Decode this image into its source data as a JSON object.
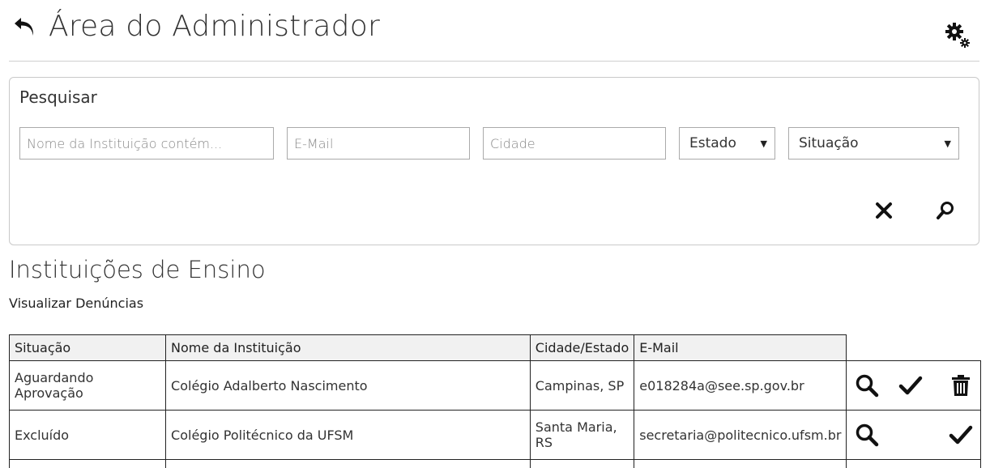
{
  "header": {
    "title": "Área do Administrador"
  },
  "search": {
    "title": "Pesquisar",
    "name_placeholder": "Nome da Instituição contém...",
    "email_placeholder": "E-Mail",
    "city_placeholder": "Cidade",
    "state_selected": "Estado",
    "status_selected": "Situação"
  },
  "section": {
    "title": "Instituições de Ensino",
    "denuncias_link": "Visualizar Denúncias"
  },
  "table": {
    "headers": [
      "Situação",
      "Nome da Instituição",
      "Cidade/Estado",
      "E-Mail"
    ],
    "rows": [
      {
        "status": "Aguardando Aprovação",
        "name": "Colégio Adalberto Nascimento",
        "city": "Campinas, SP",
        "email": "e018284a@see.sp.gov.br"
      },
      {
        "status": "Excluído",
        "name": "Colégio Politécnico da UFSM",
        "city": "Santa Maria, RS",
        "email": "secretaria@politecnico.ufsm.br"
      }
    ]
  },
  "colors": {
    "pending": "#e8500f",
    "deleted": "#e01e1e"
  },
  "icons": [
    "back-arrow-icon",
    "gear-icon",
    "close-icon",
    "search-icon",
    "magnifier-icon",
    "check-icon",
    "trash-icon"
  ]
}
